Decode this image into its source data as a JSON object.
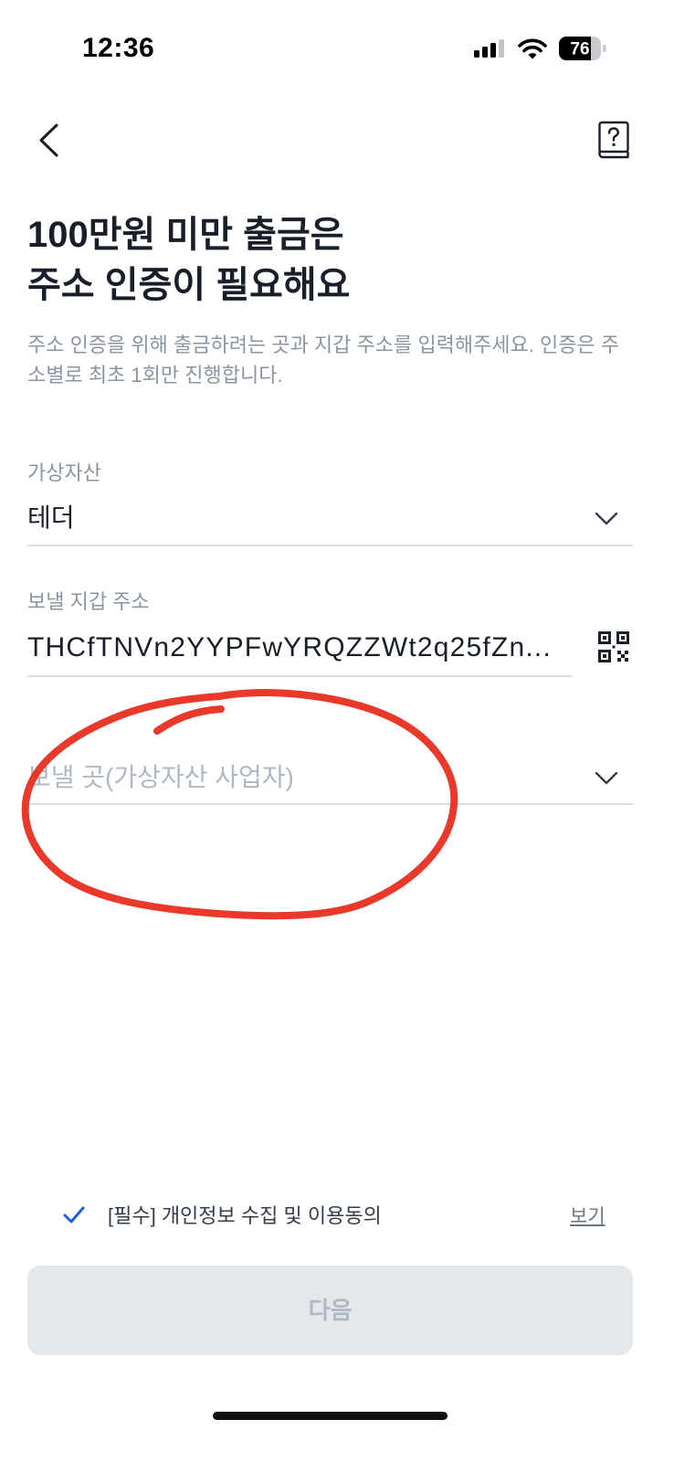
{
  "status_bar": {
    "time": "12:36",
    "battery_level": "76",
    "icons": [
      "cellular-signal-icon",
      "wifi-icon",
      "battery-icon"
    ]
  },
  "header": {
    "back_icon": "chevron-left-icon",
    "help_icon": "help-book-icon"
  },
  "title": {
    "lines": [
      "100만원 미만 출금은",
      "주소 인증이 필요해요"
    ]
  },
  "description": "주소 인증을 위해 출금하려는 곳과 지갑 주소를 입력해주세요. 인증은 주소별로 최초 1회만 진행합니다.",
  "form": {
    "asset": {
      "label": "가상자산",
      "value": "테더",
      "icon": "chevron-down-icon"
    },
    "wallet_address": {
      "label": "보낼 지갑 주소",
      "value": "THCfTNVn2YYPFwYRQZZWt2q25fZn...",
      "icon": "qr-code-icon"
    },
    "destination": {
      "placeholder": "보낼 곳(가상자산 사업자)",
      "icon": "chevron-down-icon"
    }
  },
  "consent": {
    "checked": true,
    "text": "[필수] 개인정보 수집 및 이용동의",
    "view_link": "보기",
    "icon": "check-icon"
  },
  "next_button": {
    "label": "다음",
    "enabled": false
  },
  "colors": {
    "text_primary": "#191f28",
    "text_secondary": "#8b95a1",
    "placeholder": "#b0b8c1",
    "divider": "#d9dee3",
    "accent_blue": "#1d5fd9",
    "button_disabled_bg": "#e5e8eb",
    "button_disabled_text": "#b0b8c1",
    "annotation_red": "#e8392b"
  }
}
